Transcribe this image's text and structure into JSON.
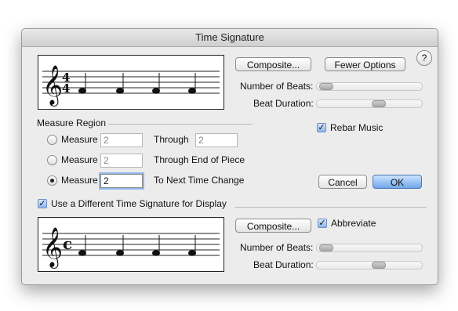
{
  "title": "Time Signature",
  "help_label": "?",
  "top": {
    "composite_label": "Composite...",
    "fewer_options_label": "Fewer Options",
    "beats_label": "Number of Beats:",
    "duration_label": "Beat Duration:",
    "beats_level": 0.05,
    "duration_level": 0.6,
    "time_sig_numerator": "4",
    "time_sig_denominator": "4"
  },
  "measure_region": {
    "heading": "Measure Region",
    "rows": [
      {
        "radio_label": "Measure",
        "value": "2",
        "suffix_label": "Through",
        "through_value": "2",
        "selected": false
      },
      {
        "radio_label": "Measure",
        "value": "2",
        "suffix_label": "Through End of Piece",
        "selected": false
      },
      {
        "radio_label": "Measure",
        "value": "2",
        "suffix_label": "To Next Time Change",
        "selected": true
      }
    ]
  },
  "rebar_label": "Rebar Music",
  "rebar_checked": true,
  "cancel_label": "Cancel",
  "ok_label": "OK",
  "display": {
    "checkbox_label": "Use a Different Time Signature for Display",
    "checked": true,
    "composite_label": "Composite...",
    "abbreviate_label": "Abbreviate",
    "abbreviate_checked": true,
    "beats_label": "Number of Beats:",
    "duration_label": "Beat Duration:",
    "beats_level": 0.05,
    "duration_level": 0.6,
    "time_sig_symbol": "c"
  },
  "colors": {
    "dialog_bg": "#ececec",
    "default_button": "#6fa6ea",
    "focus_ring": "#8fb6ec"
  }
}
